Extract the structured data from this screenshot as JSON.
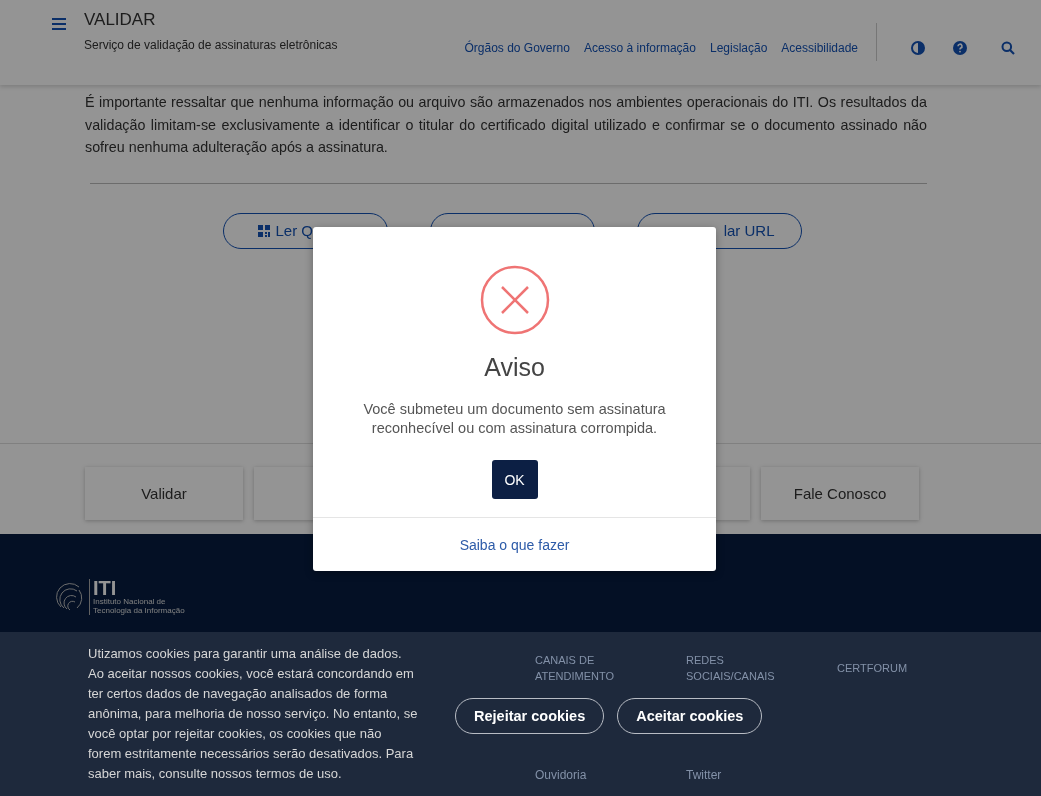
{
  "header": {
    "title": "VALIDAR",
    "subtitle": "Serviço de validação de assinaturas eletrônicas",
    "nav_links": [
      "Órgãos do Governo",
      "Acesso à informação",
      "Legislação",
      "Acessibilidade"
    ]
  },
  "intro": "É importante ressaltar que nenhuma informação ou arquivo são armazenados nos ambientes operacionais do ITI. Os resultados da validação limitam-se exclusivamente a identificar o titular do certificado digital utilizado e confirmar se o documento assinado não sofreu nenhuma adulteração após a assinatura.",
  "action_buttons": [
    {
      "kind": "qr",
      "label": "Ler Q"
    },
    {
      "kind": "covered"
    },
    {
      "kind": "url",
      "label": "lar URL"
    }
  ],
  "shortcut_tiles": [
    {
      "kind": "labeled",
      "label": "Validar"
    },
    {
      "kind": "covered"
    },
    {
      "kind": "covered"
    },
    {
      "kind": "labeled",
      "label": "Fale Conosco"
    }
  ],
  "footer": {
    "logo": {
      "name": "ITI",
      "subtitle": "Instituto Nacional de Tecnologia da Informação"
    },
    "columns": [
      {
        "heading": "CANAIS DE ATENDIMENTO",
        "links": [
          "Ouvidoria"
        ]
      },
      {
        "heading": "REDES SOCIAIS/CANAIS",
        "links": [
          "Twitter"
        ]
      },
      {
        "heading": "CERTFORUM"
      }
    ]
  },
  "dialog": {
    "title": "Aviso",
    "message": "Você submeteu um documento sem assinatura reconhecível ou com assinatura corrompida.",
    "button": "OK",
    "link": "Saiba o que fazer"
  },
  "cookie_banner": {
    "message": "Utizamos cookies para garantir uma análise de dados. Ao aceitar nossos cookies, você estará concordando em ter certos dados de navegação analisados de forma anônima, para melhoria de nosso serviço. No entanto, se você optar por rejeitar cookies, os cookies que não forem estritamente necessários serão desativados. Para saber mais, consulte nossos termos de uso.",
    "buttons": [
      "Rejeitar cookies",
      "Aceitar cookies"
    ]
  }
}
